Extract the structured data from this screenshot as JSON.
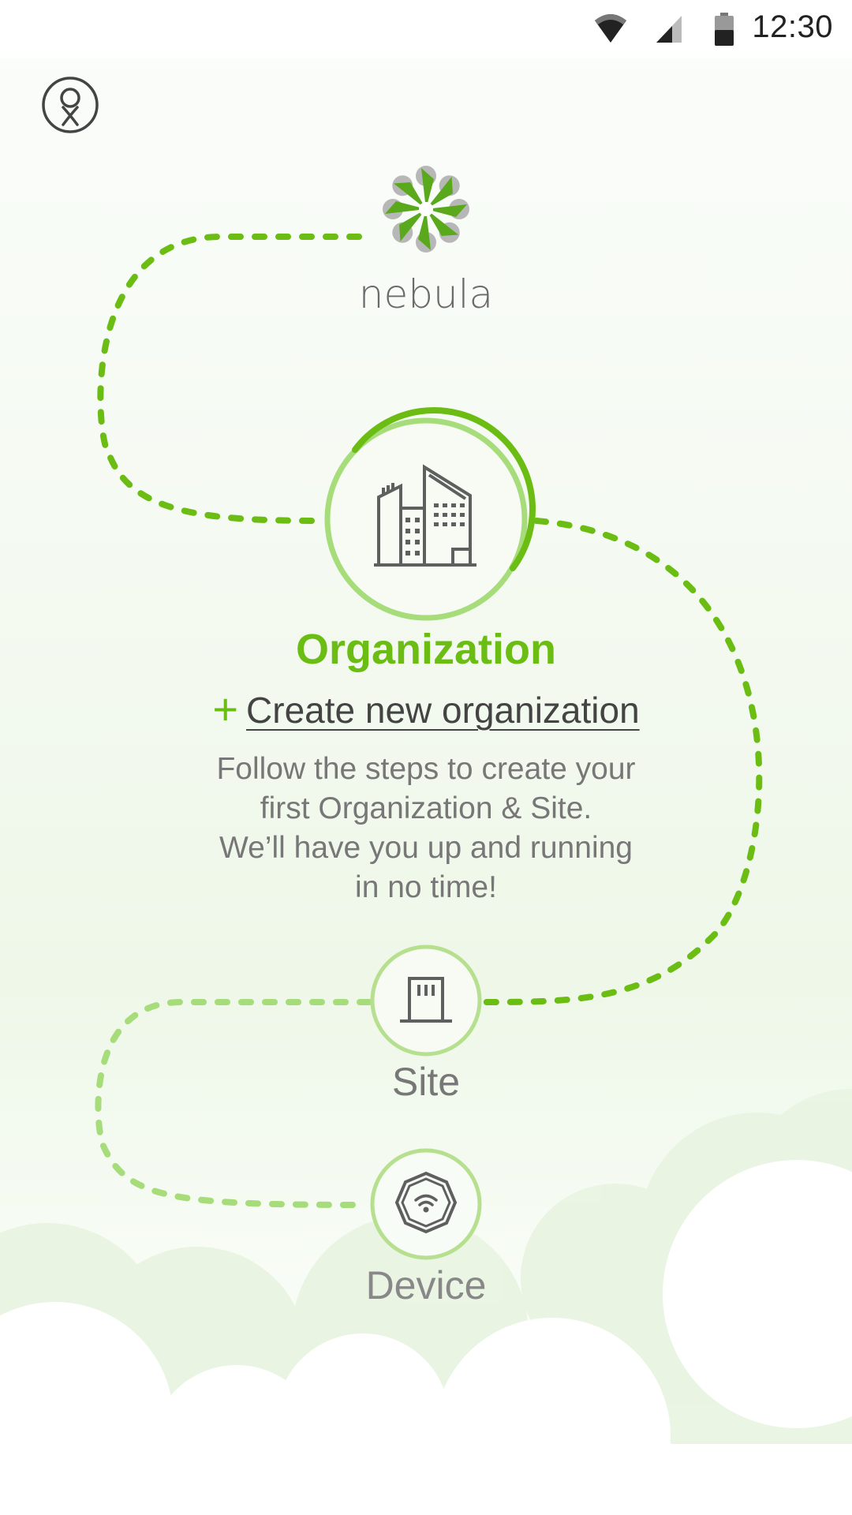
{
  "status_bar": {
    "time": "12:30",
    "icons": [
      "wifi-icon",
      "signal-icon",
      "battery-icon"
    ]
  },
  "header": {
    "profile_icon": "profile-icon"
  },
  "brand": {
    "logo_icon": "nebula-logo-icon",
    "name": "nebula"
  },
  "steps": {
    "organization": {
      "icon": "building-icon",
      "title": "Organization",
      "action_icon": "plus-icon",
      "action_label": "Create new organization",
      "description": [
        "Follow the steps to create your",
        "first Organization & Site.",
        "We’ll have you up and running",
        "in no time!"
      ]
    },
    "site": {
      "icon": "site-door-icon",
      "label": "Site"
    },
    "device": {
      "icon": "wifi-device-icon",
      "label": "Device"
    }
  },
  "colors": {
    "accent": "#6bbd14",
    "accent_light": "#a6dd7a",
    "path_dark": "#6bbd14",
    "path_light": "#a6dd7a",
    "text_gray": "#777777",
    "icon_gray": "#5f5f5f"
  }
}
